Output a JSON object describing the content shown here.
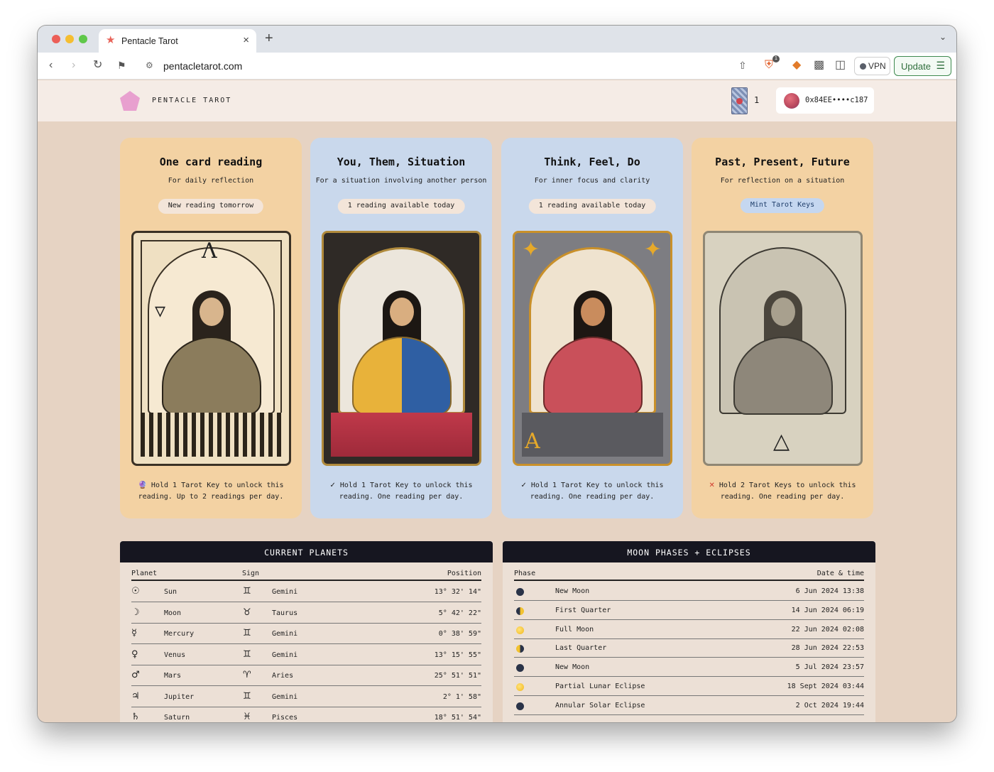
{
  "browser": {
    "tab_title": "Pentacle Tarot",
    "tab_close": "×",
    "new_tab": "+",
    "url": "pentacletarot.com",
    "vpn_label": "VPN",
    "update_label": "Update",
    "shield_badge": "1"
  },
  "header": {
    "brand": "PENTACLE TAROT",
    "key_count": "1",
    "wallet_address": "0x84EE••••c187"
  },
  "readings": [
    {
      "title": "One card reading",
      "subtitle": "For daily reflection",
      "status": "New reading tomorrow",
      "mark": "🔮",
      "note": "Hold 1 Tarot Key to unlock this reading. Up to 2 readings per day."
    },
    {
      "title": "You, Them, Situation",
      "subtitle": "For a situation involving another person",
      "status": "1 reading available today",
      "mark": "✓",
      "note": "Hold 1 Tarot Key to unlock this reading. One reading per day."
    },
    {
      "title": "Think, Feel, Do",
      "subtitle": "For inner focus and clarity",
      "status": "1 reading available today",
      "mark": "✓",
      "note": "Hold 1 Tarot Key to unlock this reading. One reading per day."
    },
    {
      "title": "Past, Present, Future",
      "subtitle": "For reflection on a situation",
      "status": "Mint Tarot Keys",
      "mark": "✕",
      "note": "Hold 2 Tarot Keys to unlock this reading. One reading per day."
    }
  ],
  "planets": {
    "title": "CURRENT PLANETS",
    "columns": [
      "Planet",
      "Sign",
      "Position"
    ],
    "rows": [
      {
        "planet_symbol": "☉",
        "planet": "Sun",
        "sign_symbol": "♊",
        "sign": "Gemini",
        "position": "13° 32' 14\""
      },
      {
        "planet_symbol": "☽",
        "planet": "Moon",
        "sign_symbol": "♉",
        "sign": "Taurus",
        "position": "5° 42' 22\""
      },
      {
        "planet_symbol": "☿",
        "planet": "Mercury",
        "sign_symbol": "♊",
        "sign": "Gemini",
        "position": "0° 38' 59\""
      },
      {
        "planet_symbol": "♀",
        "planet": "Venus",
        "sign_symbol": "♊",
        "sign": "Gemini",
        "position": "13° 15' 55\""
      },
      {
        "planet_symbol": "♂",
        "planet": "Mars",
        "sign_symbol": "♈",
        "sign": "Aries",
        "position": "25° 51' 51\""
      },
      {
        "planet_symbol": "♃",
        "planet": "Jupiter",
        "sign_symbol": "♊",
        "sign": "Gemini",
        "position": "2° 1' 58\""
      },
      {
        "planet_symbol": "♄",
        "planet": "Saturn",
        "sign_symbol": "♓",
        "sign": "Pisces",
        "position": "18° 51' 54\""
      }
    ]
  },
  "moons": {
    "title": "MOON PHASES + ECLIPSES",
    "columns": [
      "Phase",
      "Date & time"
    ],
    "rows": [
      {
        "icon": "new-moon",
        "phase": "New Moon",
        "date": "6 Jun 2024 13:38"
      },
      {
        "icon": "first-quarter",
        "phase": "First Quarter",
        "date": "14 Jun 2024 06:19"
      },
      {
        "icon": "full-moon",
        "phase": "Full Moon",
        "date": "22 Jun 2024 02:08"
      },
      {
        "icon": "last-quarter",
        "phase": "Last Quarter",
        "date": "28 Jun 2024 22:53"
      },
      {
        "icon": "new-moon",
        "phase": "New Moon",
        "date": "5 Jul 2024 23:57"
      },
      {
        "icon": "full-moon",
        "phase": "Partial Lunar Eclipse",
        "date": "18 Sept 2024 03:44"
      },
      {
        "icon": "new-moon",
        "phase": "Annular Solar Eclipse",
        "date": "2 Oct 2024 19:44"
      }
    ]
  },
  "colors": {
    "page_bg": "#e6d3c3",
    "panel_orange": "#f3d2a3",
    "panel_blue": "#c9d8ec",
    "table_header": "#161620",
    "logo_pink": "#e8a0cf"
  }
}
